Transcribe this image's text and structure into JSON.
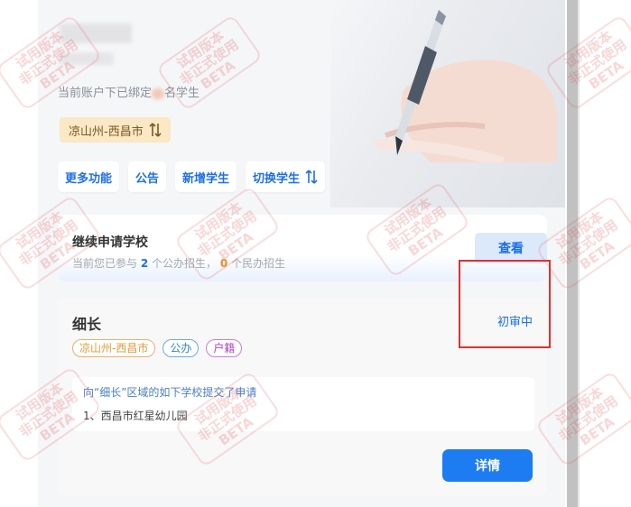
{
  "header": {
    "bind_info_prefix": "当前账户下已绑定",
    "bind_info_suffix": "名学生",
    "region": "凉山州-西昌市"
  },
  "quick_actions": [
    "更多功能",
    "公告",
    "新增学生",
    "切换学生"
  ],
  "apply_card": {
    "title": "继续申请学校",
    "desc_prefix": "当前您已参与",
    "public_count": "2",
    "desc_mid": "个公办招生，",
    "private_count": "0",
    "desc_suffix": "个民办招生",
    "view_label": "查看"
  },
  "status_card": {
    "child_name": "细长",
    "status": "初审中",
    "tags": [
      "凉山州-西昌市",
      "公办",
      "户籍"
    ],
    "apply_line": "向“细长”区域的如下学校提交了申请",
    "school_line": "1、西昌市红星幼儿园",
    "detail_label": "详情"
  },
  "watermark": {
    "line1": "试用版本",
    "line2": "非正式使用",
    "line3": "BETA"
  },
  "colors": {
    "primary": "#1d7cf2",
    "highlight_border": "#e52e2e",
    "region_chip_bg": "#fbe8c4"
  }
}
